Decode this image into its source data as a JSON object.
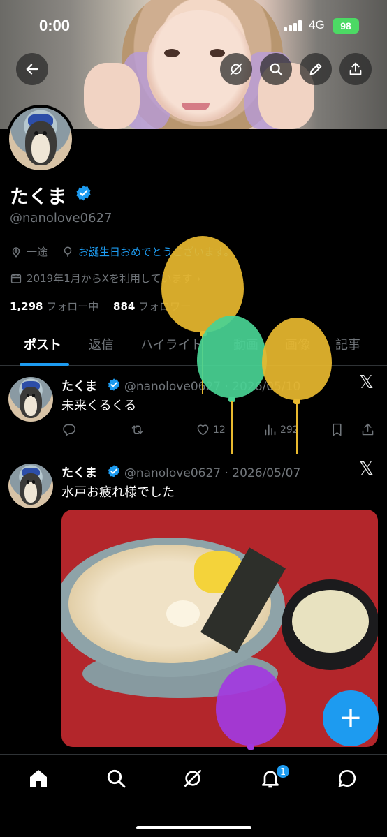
{
  "status_bar": {
    "time": "0:00",
    "network": "4G",
    "battery": "98"
  },
  "profile": {
    "name": "たくま",
    "handle": "@nanolove0627",
    "location": "一途",
    "birthday_text": "お誕生日おめでとうございます。",
    "joined": "2019年1月からXを利用しています",
    "following_count": "1,298",
    "following_label": "フォロー中",
    "followers_count": "884",
    "followers_label": "フォロワー"
  },
  "tabs": [
    "ポスト",
    "返信",
    "ハイライト",
    "動画",
    "画像",
    "記事"
  ],
  "posts": [
    {
      "name": "たくま",
      "meta": "@nanolove0627 · 2026/05/10",
      "text": "未来くるくる",
      "likes": "12",
      "views": "292"
    },
    {
      "name": "たくま",
      "meta": "@nanolove0627 · 2026/05/07",
      "text": "水戸お疲れ様でした"
    }
  ],
  "fab_label": "+",
  "notification_badge": "1",
  "colors": {
    "accent": "#1d9bf0",
    "background": "#000000",
    "muted": "#71767b",
    "battery": "#4cd964"
  },
  "icons": [
    "back-arrow-icon",
    "grok-icon",
    "search-icon",
    "edit-icon",
    "share-icon",
    "location-icon",
    "balloon-icon",
    "calendar-icon",
    "verified-icon",
    "x-logo-icon",
    "reply-icon",
    "repost-icon",
    "like-icon",
    "views-icon",
    "bookmark-icon",
    "home-icon",
    "notifications-icon",
    "messages-icon"
  ]
}
